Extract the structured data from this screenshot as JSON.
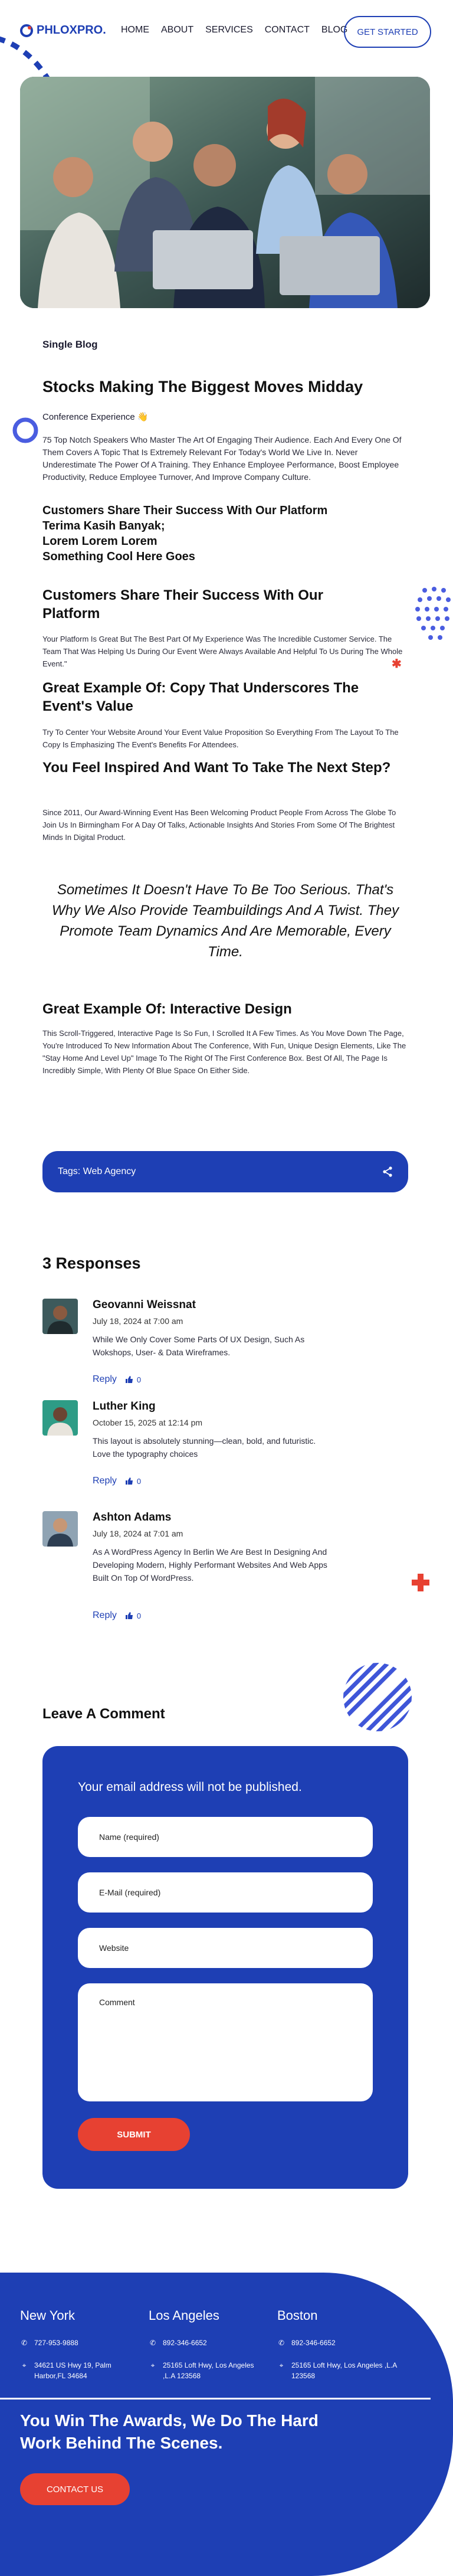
{
  "brand": {
    "name": "PHLOXPRO.",
    "accent": "#1e3fb4",
    "red": "#e74132"
  },
  "nav": {
    "items": [
      "HOME",
      "ABOUT",
      "SERVICES",
      "CONTACT",
      "BLOG"
    ],
    "cta": "GET STARTED"
  },
  "hero": {
    "icon": "team-photo"
  },
  "post": {
    "category": "Single Blog",
    "title": "Stocks Making The Biggest Moves Midday",
    "experience": "Conference Experience 👋",
    "intro": "75 Top Notch Speakers Who Master The Art Of Engaging Their Audience. Each And Every One Of Them Covers A Topic That Is Extremely Relevant For Today's World We Live In. Never Underestimate The Power Of A Training. They Enhance Employee Performance, Boost Employee Productivity, Reduce Employee Turnover, And Improve Company Culture.",
    "subheads": [
      "Customers Share Their Success With Our Platform",
      "Terima Kasih Banyak;",
      "Lorem Lorem Lorem",
      "Something Cool Here Goes"
    ],
    "h2_platform": "Customers Share Their Success With Our Platform",
    "p_platform": "Your Platform Is Great But The Best Part Of My Experience Was The Incredible Customer Service. The Team That Was Helping Us During Our Event Were Always Available And Helpful To Us During The Whole Event.\"",
    "h2_copy": "Great Example Of: Copy That Underscores The Event's Value",
    "p_copy": "Try To Center Your Website Around Your Event Value Proposition So Everything From The Layout To The Copy Is Emphasizing The Event's Benefits For Attendees.",
    "h2_inspired": "You Feel Inspired And Want To Take The Next Step?",
    "p_inspired": "Since 2011, Our Award-Winning Event Has Been Welcoming Product People From Across The Globe To Join Us In Birmingham For A Day Of Talks, Actionable Insights And Stories From Some Of The Brightest Minds In Digital Product.",
    "quote": "Sometimes It Doesn't Have To Be Too Serious. That's Why We Also Provide Teambuildings And A Twist. They Promote Team Dynamics And Are Memorable, Every Time.",
    "h2_interactive": "Great Example Of: Interactive Design",
    "p_interactive": "This Scroll-Triggered, Interactive Page Is So Fun, I Scrolled It A Few Times. As You Move Down The Page, You're Introduced To New Information About The Conference, With Fun, Unique Design Elements, Like The \"Stay Home And Level Up\" Image To The Right Of The First Conference Box. Best Of All, The Page Is Incredibly Simple, With Plenty Of Blue Space On Either Side.",
    "tags": "Tags: Web Agency"
  },
  "comments": {
    "heading": "3 Responses",
    "reply_label": "Reply",
    "items": [
      {
        "name": "Geovanni Weissnat",
        "date": "July 18, 2024 at 7:00 am",
        "text": "While We Only Cover Some Parts Of UX Design, Such As Wokshops, User- & Data Wireframes.",
        "likes": "0"
      },
      {
        "name": "Luther King",
        "date": "October 15, 2025 at 12:14 pm",
        "text": "This layout is absolutely stunning—clean, bold, and futuristic. Love the typography choices",
        "likes": "0"
      },
      {
        "name": "Ashton Adams",
        "date": "July 18, 2024 at 7:01 am",
        "text": "As A WordPress Agency In Berlin We Are Best In Designing And Developing Modern, Highly Performant Websites And Web Apps Built On Top Of WordPress.",
        "likes": "0"
      }
    ]
  },
  "form": {
    "heading": "Leave A Comment",
    "intro": "Your email address will not be published.",
    "name_placeholder": "Name (required)",
    "email_placeholder": "E-Mail (required)",
    "website_placeholder": "Website",
    "comment_placeholder": "Comment",
    "submit": "SUBMIT"
  },
  "footer": {
    "cities": [
      {
        "name": "New York",
        "phone": "727-953-9888",
        "address": "34621 US Hwy 19, Palm Harbor,FL 34684"
      },
      {
        "name": "Los Angeles",
        "phone": "892-346-6652",
        "address": "25165 Loft Hwy, Los Angeles ,L.A 123568"
      },
      {
        "name": "Boston",
        "phone": "892-346-6652",
        "address": "25165 Loft Hwy, Los Angeles ,L.A 123568"
      }
    ],
    "headline": "You Win The Awards, We Do The Hard Work Behind The Scenes.",
    "cta": "CONTACT US"
  }
}
